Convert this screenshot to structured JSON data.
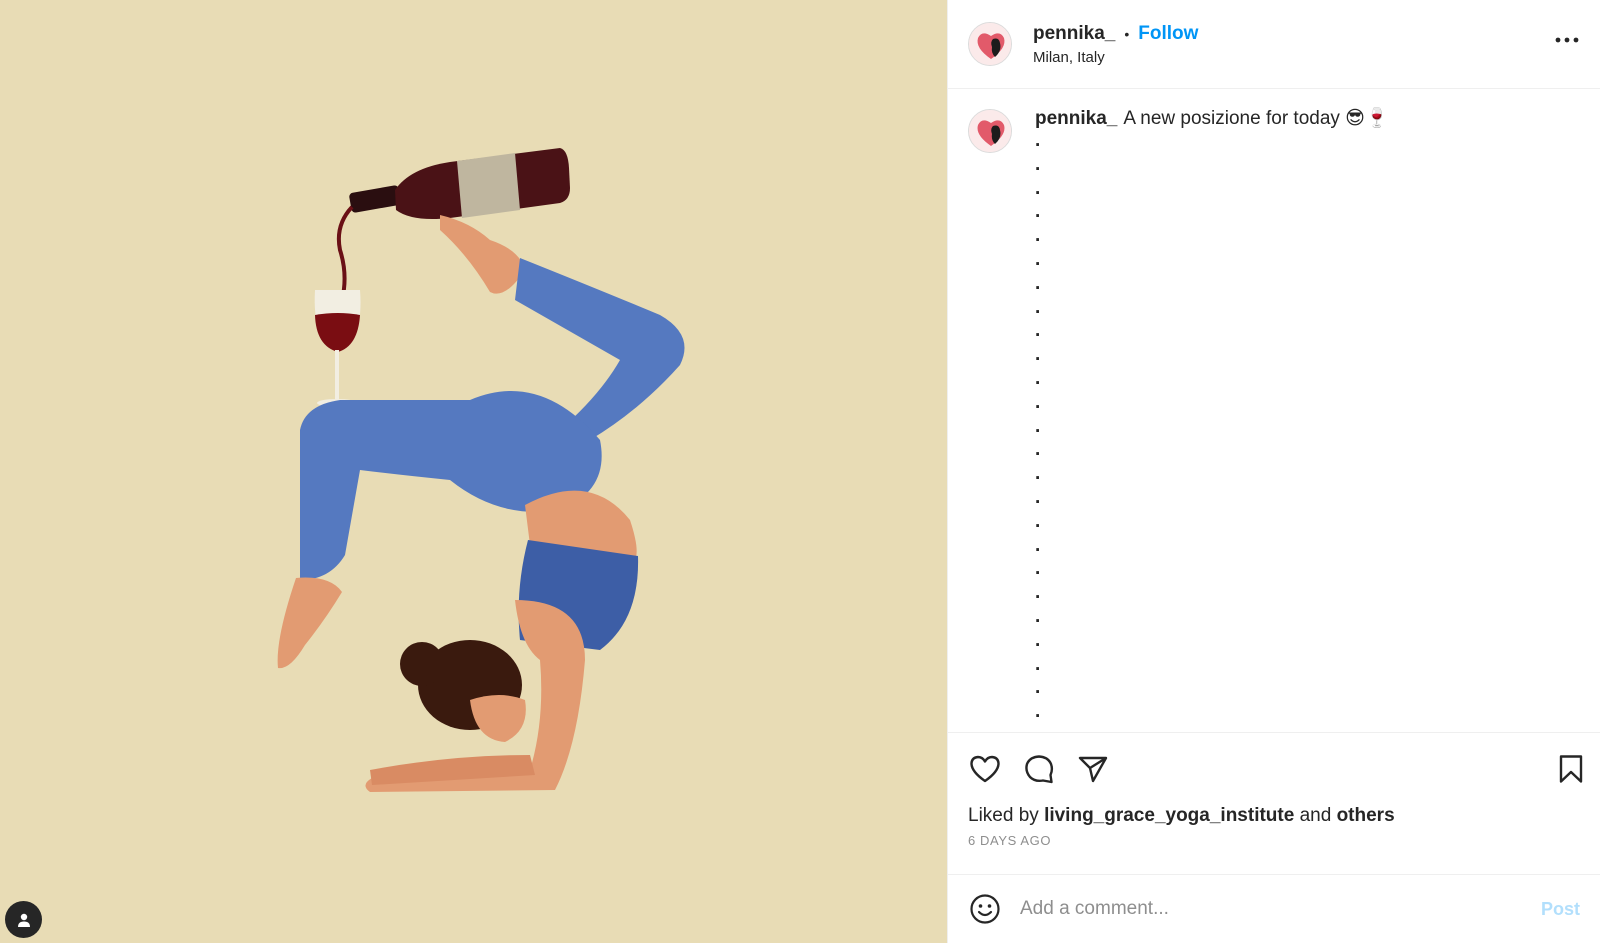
{
  "post": {
    "username": "pennika_",
    "separator": "•",
    "follow_label": "Follow",
    "location": "Milan, Italy",
    "more_icon": "more-options-icon"
  },
  "caption": {
    "username": "pennika_",
    "text": "A new posizione for today 😎🍷",
    "dot_lines": [
      ".",
      ".",
      ".",
      ".",
      ".",
      ".",
      ".",
      ".",
      ".",
      ".",
      ".",
      ".",
      ".",
      ".",
      ".",
      ".",
      ".",
      ".",
      ".",
      ".",
      ".",
      ".",
      ".",
      ".",
      "."
    ]
  },
  "actions": {
    "like_icon": "heart-icon",
    "comment_icon": "comment-icon",
    "share_icon": "paper-plane-icon",
    "save_icon": "bookmark-icon"
  },
  "likes": {
    "prefix": "Liked by",
    "first_liker": "living_grace_yoga_institute",
    "conjunction": "and",
    "others": "others"
  },
  "timestamp": "6 DAYS AGO",
  "comment_box": {
    "placeholder": "Add a comment...",
    "post_label": "Post",
    "emoji_icon": "smiley-icon"
  },
  "colors": {
    "media_bg": "#e8dcb5",
    "accent": "#0095f6",
    "post_disabled": "#b2dffc"
  }
}
